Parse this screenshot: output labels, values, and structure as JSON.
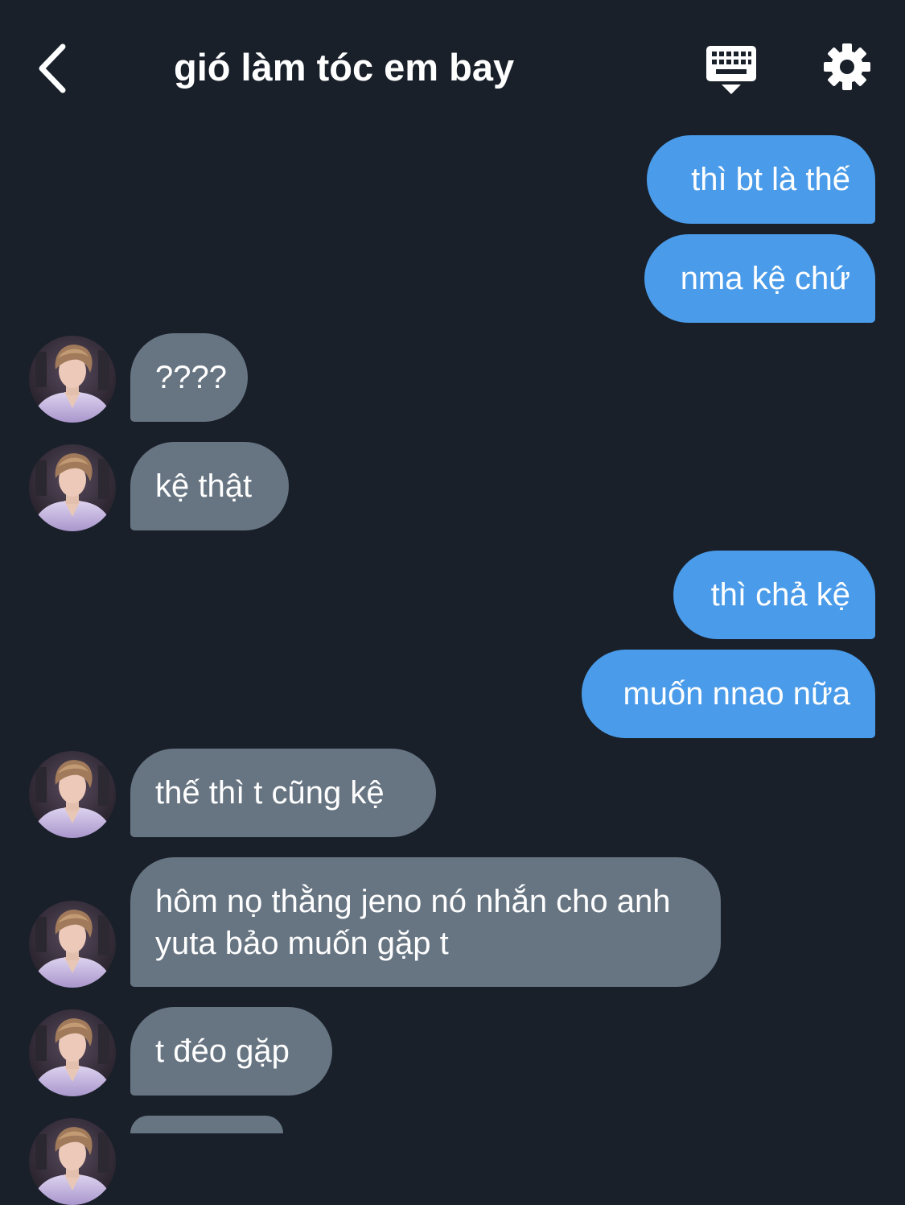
{
  "header": {
    "title": "gió làm tóc em bay",
    "back_icon": "chevron-left-icon",
    "keyboard_icon": "keyboard-icon",
    "settings_icon": "gear-icon"
  },
  "colors": {
    "background": "#19202a",
    "sent_bubble": "#4a9be9",
    "received_bubble": "#677482",
    "text": "#ffffff"
  },
  "messages": [
    {
      "from": "me",
      "text": "thì bt là thế"
    },
    {
      "from": "me",
      "text": "nma kệ chứ"
    },
    {
      "from": "them",
      "text": "????"
    },
    {
      "from": "them",
      "text": "kệ thật"
    },
    {
      "from": "me",
      "text": "thì chả kệ"
    },
    {
      "from": "me",
      "text": "muốn nnao nữa"
    },
    {
      "from": "them",
      "text": "thế thì t cũng kệ"
    },
    {
      "from": "them",
      "text": "hôm nọ thằng jeno nó nhắn cho anh yuta bảo muốn gặp t"
    },
    {
      "from": "them",
      "text": "t đéo gặp"
    }
  ]
}
